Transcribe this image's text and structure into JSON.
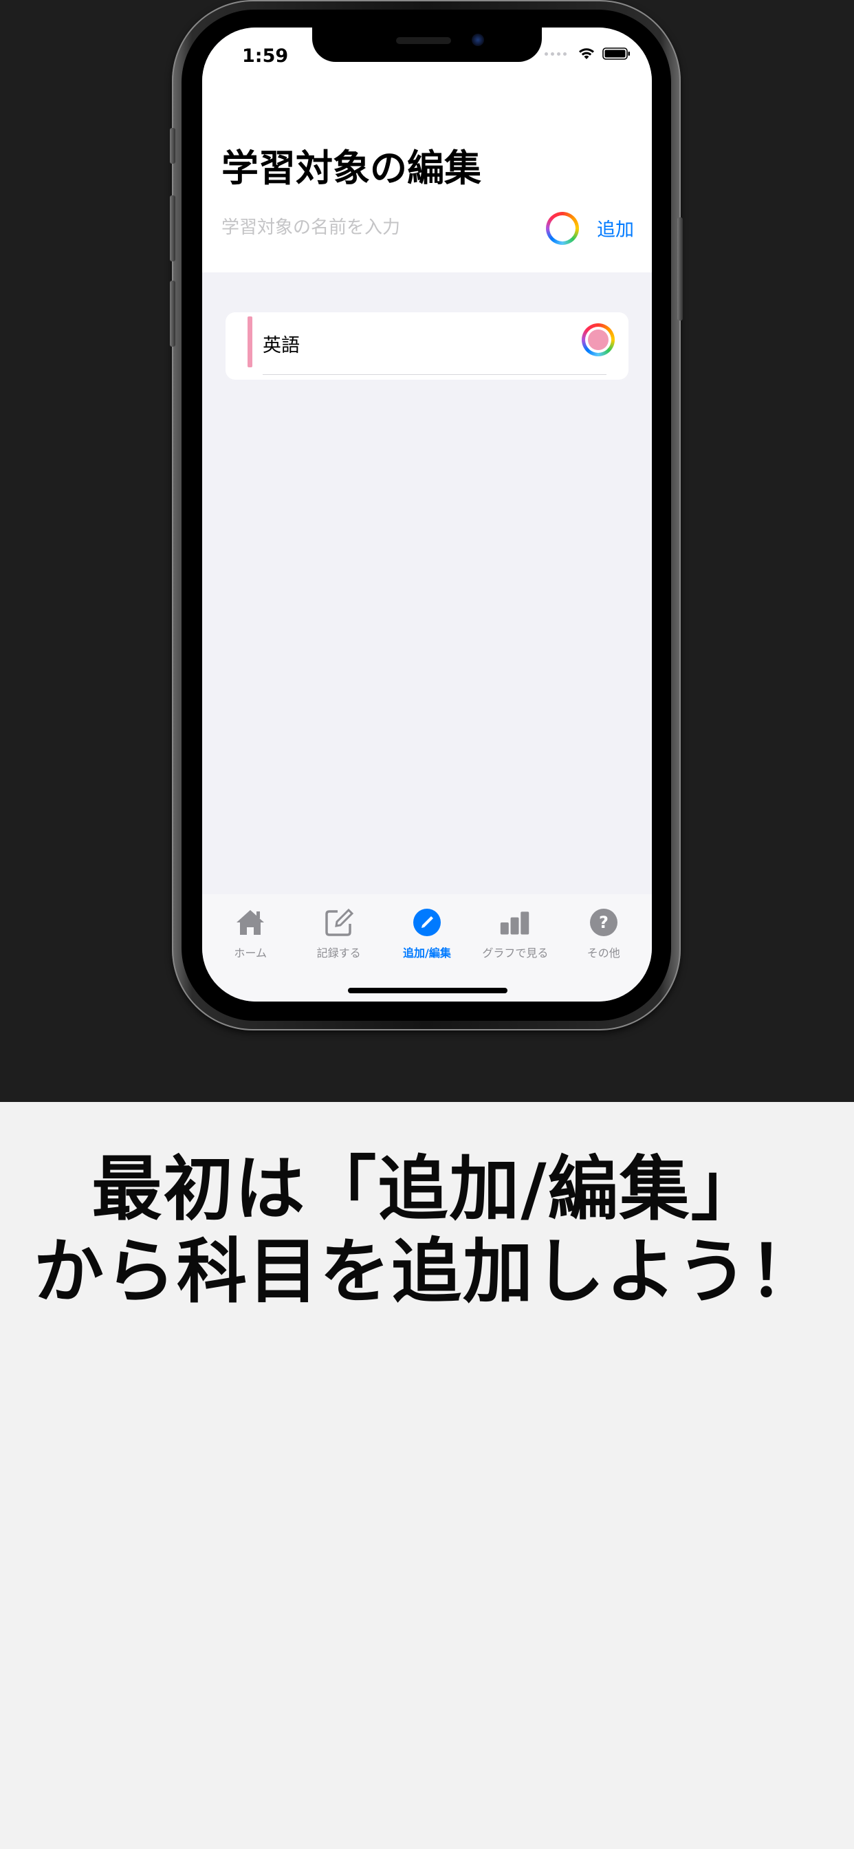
{
  "status_bar": {
    "time": "1:59"
  },
  "header": {
    "title": "学習対象の編集",
    "name_input": {
      "placeholder": "学習対象の名前を入力",
      "value": ""
    },
    "add_label": "追加"
  },
  "subjects": [
    {
      "name": "英語",
      "color": "#f29ab5"
    }
  ],
  "tab_bar": {
    "items": [
      {
        "label": "ホーム",
        "icon": "house-icon",
        "active": false
      },
      {
        "label": "記録する",
        "icon": "compose-icon",
        "active": false
      },
      {
        "label": "追加/編集",
        "icon": "pencil-circle-icon",
        "active": true
      },
      {
        "label": "グラフで見る",
        "icon": "bar-chart-icon",
        "active": false
      },
      {
        "label": "その他",
        "icon": "question-circle-icon",
        "active": false
      }
    ]
  },
  "caption": {
    "line1": "最初は「追加/編集」",
    "line2": "から科目を追加しよう！"
  },
  "colors": {
    "accent": "#007aff",
    "inactive": "#8e8e93",
    "subject_stripe": "#f29ab5",
    "background": "#f2f2f7",
    "frame_background": "#1e1e1e",
    "caption_background": "#f2f2f2"
  }
}
